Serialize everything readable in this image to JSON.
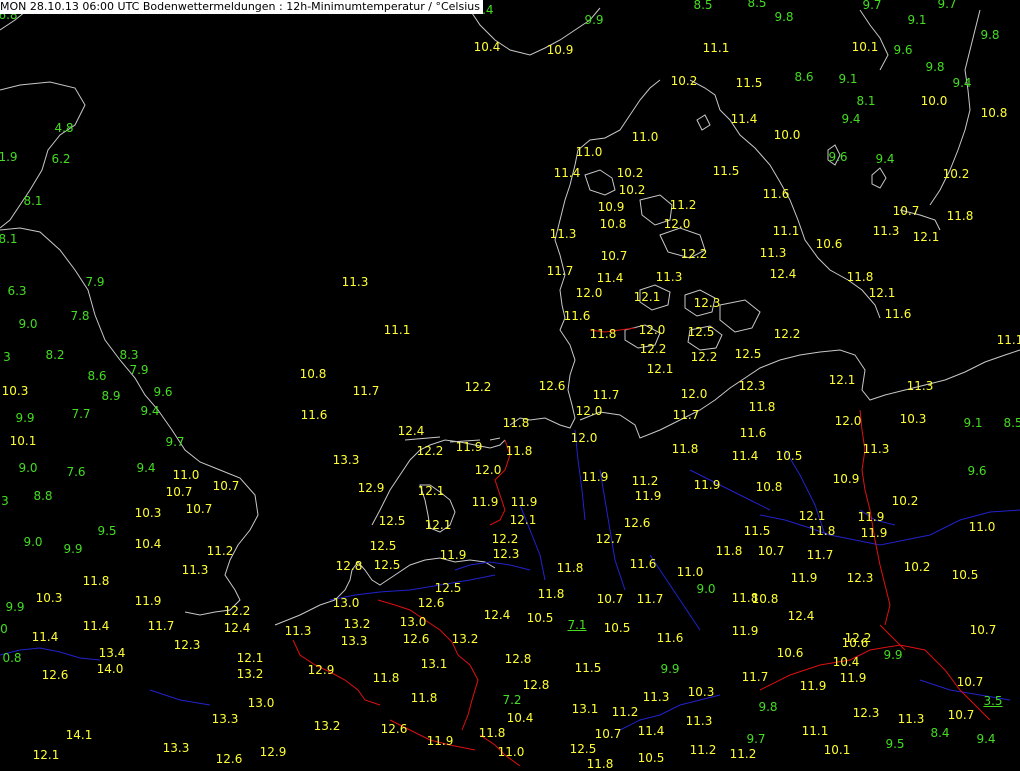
{
  "header": {
    "title": "MON 28.10.13 06:00 UTC  Bodenwettermeldungen :  12h-Minimumtemperatur / °Celsius"
  },
  "colors": {
    "background": "#000000",
    "coastline": "#c8c8c8",
    "river": "#2222cc",
    "border": "#dd1111",
    "value_above_11": "#ffff33",
    "value_below_11": "#44dd22"
  },
  "stations": [
    {
      "v": "6.8"
    },
    {
      "v": "8.4"
    },
    {
      "v": "9.9"
    },
    {
      "v": "10.4"
    },
    {
      "v": "10.9"
    },
    {
      "v": "8.5"
    },
    {
      "v": "8.5"
    },
    {
      "v": "9.7"
    },
    {
      "v": "9.7"
    },
    {
      "v": "9.8"
    },
    {
      "v": "9.1"
    },
    {
      "v": "9.8"
    },
    {
      "v": "11.1"
    },
    {
      "v": "10.1"
    },
    {
      "v": "9.6"
    },
    {
      "v": "9.8"
    },
    {
      "v": "10.2"
    },
    {
      "v": "11.5"
    },
    {
      "v": "8.6"
    },
    {
      "v": "9.1"
    },
    {
      "v": "9.4"
    },
    {
      "v": "10.0"
    },
    {
      "v": "10.8"
    },
    {
      "v": "8.1"
    },
    {
      "v": "9.4"
    },
    {
      "v": "11.4"
    },
    {
      "v": "10.0"
    },
    {
      "v": "4.8"
    },
    {
      "v": "1.9"
    },
    {
      "v": "6.2"
    },
    {
      "v": "11.0"
    },
    {
      "v": "11.0"
    },
    {
      "v": "10.2"
    },
    {
      "v": "11.4"
    },
    {
      "v": "10.2"
    },
    {
      "v": "9.6"
    },
    {
      "v": "9.4"
    },
    {
      "v": "11.5"
    },
    {
      "v": "10.2"
    },
    {
      "v": "8.1"
    },
    {
      "v": "11.6"
    },
    {
      "v": "10.9"
    },
    {
      "v": "11.2"
    },
    {
      "v": "10.7"
    },
    {
      "v": "11.8"
    },
    {
      "v": "10.8"
    },
    {
      "v": "12.0"
    },
    {
      "v": "11.3"
    },
    {
      "v": "11.1"
    },
    {
      "v": "11.3"
    },
    {
      "v": "12.1"
    },
    {
      "v": "8.1"
    },
    {
      "v": "10.6"
    },
    {
      "v": "10.7"
    },
    {
      "v": "12.2"
    },
    {
      "v": "11.3"
    },
    {
      "v": "11.7"
    },
    {
      "v": "11.4"
    },
    {
      "v": "11.3"
    },
    {
      "v": "12.4"
    },
    {
      "v": "11.8"
    },
    {
      "v": "7.9"
    },
    {
      "v": "11.3"
    },
    {
      "v": "12.0"
    },
    {
      "v": "6.3"
    },
    {
      "v": "12.1"
    },
    {
      "v": "12.1"
    },
    {
      "v": "12.3"
    },
    {
      "v": "7.8"
    },
    {
      "v": "11.6"
    },
    {
      "v": "11.6"
    },
    {
      "v": "9.0"
    },
    {
      "v": "11.1"
    },
    {
      "v": "11.8"
    },
    {
      "v": "12.0"
    },
    {
      "v": "12.5"
    },
    {
      "v": "12.2"
    },
    {
      "v": "11.1"
    },
    {
      "v": "8.2"
    },
    {
      "v": "8.3"
    },
    {
      "v": "12.2"
    },
    {
      "v": "7.9"
    },
    {
      "v": "12.2"
    },
    {
      "v": "12.5"
    },
    {
      "v": "12.1"
    },
    {
      "v": "3"
    },
    {
      "v": "10.8"
    },
    {
      "v": "8.6"
    },
    {
      "v": "12.1"
    },
    {
      "v": "11.3"
    },
    {
      "v": "12.6"
    },
    {
      "v": "12.3"
    },
    {
      "v": "10.3"
    },
    {
      "v": "12.2"
    },
    {
      "v": "11.7"
    },
    {
      "v": "8.9"
    },
    {
      "v": "9.6"
    },
    {
      "v": "11.7"
    },
    {
      "v": "12.0"
    },
    {
      "v": "11.8"
    },
    {
      "v": "9.9"
    },
    {
      "v": "7.7"
    },
    {
      "v": "9.4"
    },
    {
      "v": "11.6"
    },
    {
      "v": "12.0"
    },
    {
      "v": "11.7"
    },
    {
      "v": "10.3"
    },
    {
      "v": "9.1"
    },
    {
      "v": "8.5"
    },
    {
      "v": "12.4"
    },
    {
      "v": "11.8"
    },
    {
      "v": "12.0"
    },
    {
      "v": "12.0"
    },
    {
      "v": "11.6"
    },
    {
      "v": "10.1"
    },
    {
      "v": "11.9"
    },
    {
      "v": "12.2"
    },
    {
      "v": "11.8"
    },
    {
      "v": "11.8"
    },
    {
      "v": "11.3"
    },
    {
      "v": "9.7"
    },
    {
      "v": "9.0"
    },
    {
      "v": "13.3"
    },
    {
      "v": "9.4"
    },
    {
      "v": "10.5"
    },
    {
      "v": "11.4"
    },
    {
      "v": "12.0"
    },
    {
      "v": "7.6"
    },
    {
      "v": "11.0"
    },
    {
      "v": "9.6"
    },
    {
      "v": "11.9"
    },
    {
      "v": "11.2"
    },
    {
      "v": "10.9"
    },
    {
      "v": "11.9"
    },
    {
      "v": "12.9"
    },
    {
      "v": "10.7"
    },
    {
      "v": "10.7"
    },
    {
      "v": "12.1"
    },
    {
      "v": "10.8"
    },
    {
      "v": "8.8"
    },
    {
      "v": "3"
    },
    {
      "v": "11.9"
    },
    {
      "v": "11.9"
    },
    {
      "v": "11.9"
    },
    {
      "v": "10.2"
    },
    {
      "v": "10.7"
    },
    {
      "v": "10.3"
    },
    {
      "v": "12.1"
    },
    {
      "v": "12.6"
    },
    {
      "v": "12.5"
    },
    {
      "v": "12.1"
    },
    {
      "v": "12.1"
    },
    {
      "v": "11.5"
    },
    {
      "v": "11.8"
    },
    {
      "v": "11.9"
    },
    {
      "v": "11.0"
    },
    {
      "v": "9.5"
    },
    {
      "v": "12.7"
    },
    {
      "v": "12.2"
    },
    {
      "v": "11.9"
    },
    {
      "v": "10.4"
    },
    {
      "v": "9.0"
    },
    {
      "v": "12.5"
    },
    {
      "v": "9.9"
    },
    {
      "v": "11.8"
    },
    {
      "v": "10.7"
    },
    {
      "v": "11.7"
    },
    {
      "v": "11.2"
    },
    {
      "v": "12.3"
    },
    {
      "v": "11.9"
    },
    {
      "v": "12.8"
    },
    {
      "v": "12.5"
    },
    {
      "v": "11.6"
    },
    {
      "v": "11.8"
    },
    {
      "v": "11.0"
    },
    {
      "v": "10.2"
    },
    {
      "v": "10.5"
    },
    {
      "v": "11.3"
    },
    {
      "v": "11.9"
    },
    {
      "v": "10.8"
    },
    {
      "v": "12.3"
    },
    {
      "v": "12.5"
    },
    {
      "v": "9.0"
    },
    {
      "v": "9.9"
    },
    {
      "v": "10.3"
    },
    {
      "v": "12.6"
    },
    {
      "v": "11.8"
    },
    {
      "v": "11.9"
    },
    {
      "v": "13.0"
    },
    {
      "v": "11.8"
    },
    {
      "v": "10.7"
    },
    {
      "v": "11.7"
    },
    {
      "v": "11.8"
    },
    {
      "v": "12.2"
    },
    {
      "v": "12.4"
    },
    {
      "v": "11.4"
    },
    {
      "v": "11.7"
    },
    {
      "v": "12.4"
    },
    {
      "v": "13.2"
    },
    {
      "v": "13.0"
    },
    {
      "v": "12.4"
    },
    {
      "v": "10.5"
    },
    {
      "v": "7.1"
    },
    {
      "v": "10.5"
    },
    {
      "v": "10.7"
    },
    {
      "v": "11.4"
    },
    {
      "v": "11.3"
    },
    {
      "v": "12.3"
    },
    {
      "v": "12.2"
    },
    {
      "v": "13.3"
    },
    {
      "v": "12.6"
    },
    {
      "v": "13.2"
    },
    {
      "v": "11.6"
    },
    {
      "v": "11.9"
    },
    {
      "v": "10.6"
    },
    {
      "v": "0"
    },
    {
      "v": "13.4"
    },
    {
      "v": "12.1"
    },
    {
      "v": "12.8"
    },
    {
      "v": "10.6"
    },
    {
      "v": "9.9"
    },
    {
      "v": "10.4"
    },
    {
      "v": "0.8"
    },
    {
      "v": "14.0"
    },
    {
      "v": "12.6"
    },
    {
      "v": "13.2"
    },
    {
      "v": "12.9"
    },
    {
      "v": "13.1"
    },
    {
      "v": "11.5"
    },
    {
      "v": "9.9"
    },
    {
      "v": "11.7"
    },
    {
      "v": "11.8"
    },
    {
      "v": "11.9"
    },
    {
      "v": "10.7"
    },
    {
      "v": "11.9"
    },
    {
      "v": "12.8"
    },
    {
      "v": "11.8"
    },
    {
      "v": "7.2"
    },
    {
      "v": "11.3"
    },
    {
      "v": "10.3"
    },
    {
      "v": "3.5"
    },
    {
      "v": "13.0"
    },
    {
      "v": "13.1"
    },
    {
      "v": "11.2"
    },
    {
      "v": "9.8"
    },
    {
      "v": "12.3"
    },
    {
      "v": "11.3"
    },
    {
      "v": "10.7"
    },
    {
      "v": "13.3"
    },
    {
      "v": "10.4"
    },
    {
      "v": "11.3"
    },
    {
      "v": "13.2"
    },
    {
      "v": "12.6"
    },
    {
      "v": "11.8"
    },
    {
      "v": "10.7"
    },
    {
      "v": "11.4"
    },
    {
      "v": "11.1"
    },
    {
      "v": "8.4"
    },
    {
      "v": "14.1"
    },
    {
      "v": "11.9"
    },
    {
      "v": "12.5"
    },
    {
      "v": "9.7"
    },
    {
      "v": "9.4"
    },
    {
      "v": "9.5"
    },
    {
      "v": "10.1"
    },
    {
      "v": "12.1"
    },
    {
      "v": "13.3"
    },
    {
      "v": "12.9"
    },
    {
      "v": "11.0"
    },
    {
      "v": "11.2"
    },
    {
      "v": "11.2"
    },
    {
      "v": "12.6"
    },
    {
      "v": "10.5"
    },
    {
      "v": "11.8"
    }
  ]
}
